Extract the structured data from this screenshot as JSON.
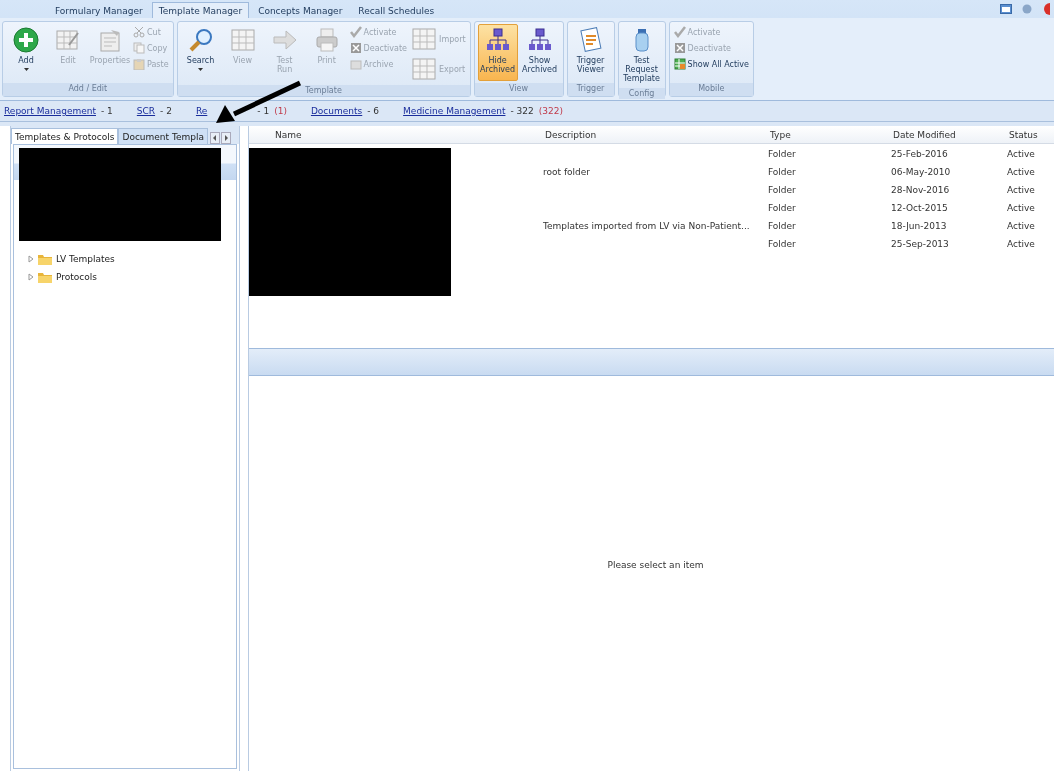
{
  "app_tabs": [
    {
      "label": "Formulary Manager",
      "selected": false
    },
    {
      "label": "Template Manager",
      "selected": true
    },
    {
      "label": "Concepts Manager",
      "selected": false
    },
    {
      "label": "Recall Schedules",
      "selected": false
    }
  ],
  "ribbon": [
    {
      "label": "Add / Edit",
      "items": [
        {
          "kind": "large",
          "label": "Add",
          "disabled": false,
          "dropdown": true
        },
        {
          "kind": "large",
          "label": "Edit",
          "disabled": true
        },
        {
          "kind": "large",
          "label": "Properties",
          "disabled": true
        },
        {
          "kind": "stack",
          "items": [
            {
              "label": "Cut",
              "disabled": true
            },
            {
              "label": "Copy",
              "disabled": true
            },
            {
              "label": "Paste",
              "disabled": true
            }
          ]
        }
      ]
    },
    {
      "label": "Template",
      "items": [
        {
          "kind": "large",
          "label": "Search",
          "disabled": false,
          "dropdown": true
        },
        {
          "kind": "large",
          "label": "View",
          "disabled": true
        },
        {
          "kind": "large",
          "label": "Test Run",
          "disabled": true
        },
        {
          "kind": "large",
          "label": "Print",
          "disabled": true
        },
        {
          "kind": "stack",
          "items": [
            {
              "label": "Activate",
              "disabled": true
            },
            {
              "label": "Deactivate",
              "disabled": true
            },
            {
              "label": "Archive",
              "disabled": true
            }
          ]
        },
        {
          "kind": "stack",
          "items": [
            {
              "label": "Import",
              "disabled": true
            },
            {
              "label": "Export",
              "disabled": true
            }
          ]
        }
      ]
    },
    {
      "label": "View",
      "items": [
        {
          "kind": "large",
          "label": "Hide Archived",
          "disabled": false,
          "selected": true
        },
        {
          "kind": "large",
          "label": "Show Archived",
          "disabled": false,
          "selected": false
        }
      ]
    },
    {
      "label": "Trigger",
      "items": [
        {
          "kind": "large",
          "label": "Trigger Viewer",
          "disabled": false
        }
      ]
    },
    {
      "label": "Config",
      "items": [
        {
          "kind": "large",
          "label": "Test Request Template",
          "disabled": false
        }
      ]
    },
    {
      "label": "Mobile",
      "items": [
        {
          "kind": "stack",
          "items": [
            {
              "label": "Activate",
              "disabled": true
            },
            {
              "label": "Deactivate",
              "disabled": true
            },
            {
              "label": "Show All Active",
              "disabled": false
            }
          ]
        }
      ]
    }
  ],
  "links": [
    {
      "label": "Report Management",
      "count": "- 1"
    },
    {
      "label": "SCR",
      "count": "- 2"
    },
    {
      "label": "Re",
      "count": "- 1",
      "alert": "(1)"
    },
    {
      "label": "Documents",
      "count": "- 6"
    },
    {
      "label": "Medicine Management",
      "count": "- 322",
      "alert": "(322)"
    }
  ],
  "left_tabs": [
    {
      "label": "Templates & Protocols",
      "selected": true
    },
    {
      "label": "Document Templa",
      "selected": false
    }
  ],
  "tree": [
    {
      "label": "LV Templates",
      "expanded": false
    },
    {
      "label": "Protocols",
      "expanded": false
    }
  ],
  "table": {
    "columns": [
      "Name",
      "Description",
      "Type",
      "Date Modified",
      "Status"
    ],
    "rows": [
      [
        "",
        "",
        "Folder",
        "25-Feb-2016",
        "Active"
      ],
      [
        "",
        "root folder",
        "Folder",
        "06-May-2010",
        "Active"
      ],
      [
        "",
        "",
        "Folder",
        "28-Nov-2016",
        "Active"
      ],
      [
        "",
        "",
        "Folder",
        "12-Oct-2015",
        "Active"
      ],
      [
        "",
        "Templates imported from LV via Non-Patient...",
        "Folder",
        "18-Jun-2013",
        "Active"
      ],
      [
        "",
        "",
        "Folder",
        "25-Sep-2013",
        "Active"
      ]
    ]
  },
  "detail": {
    "message": "Please select an item"
  }
}
